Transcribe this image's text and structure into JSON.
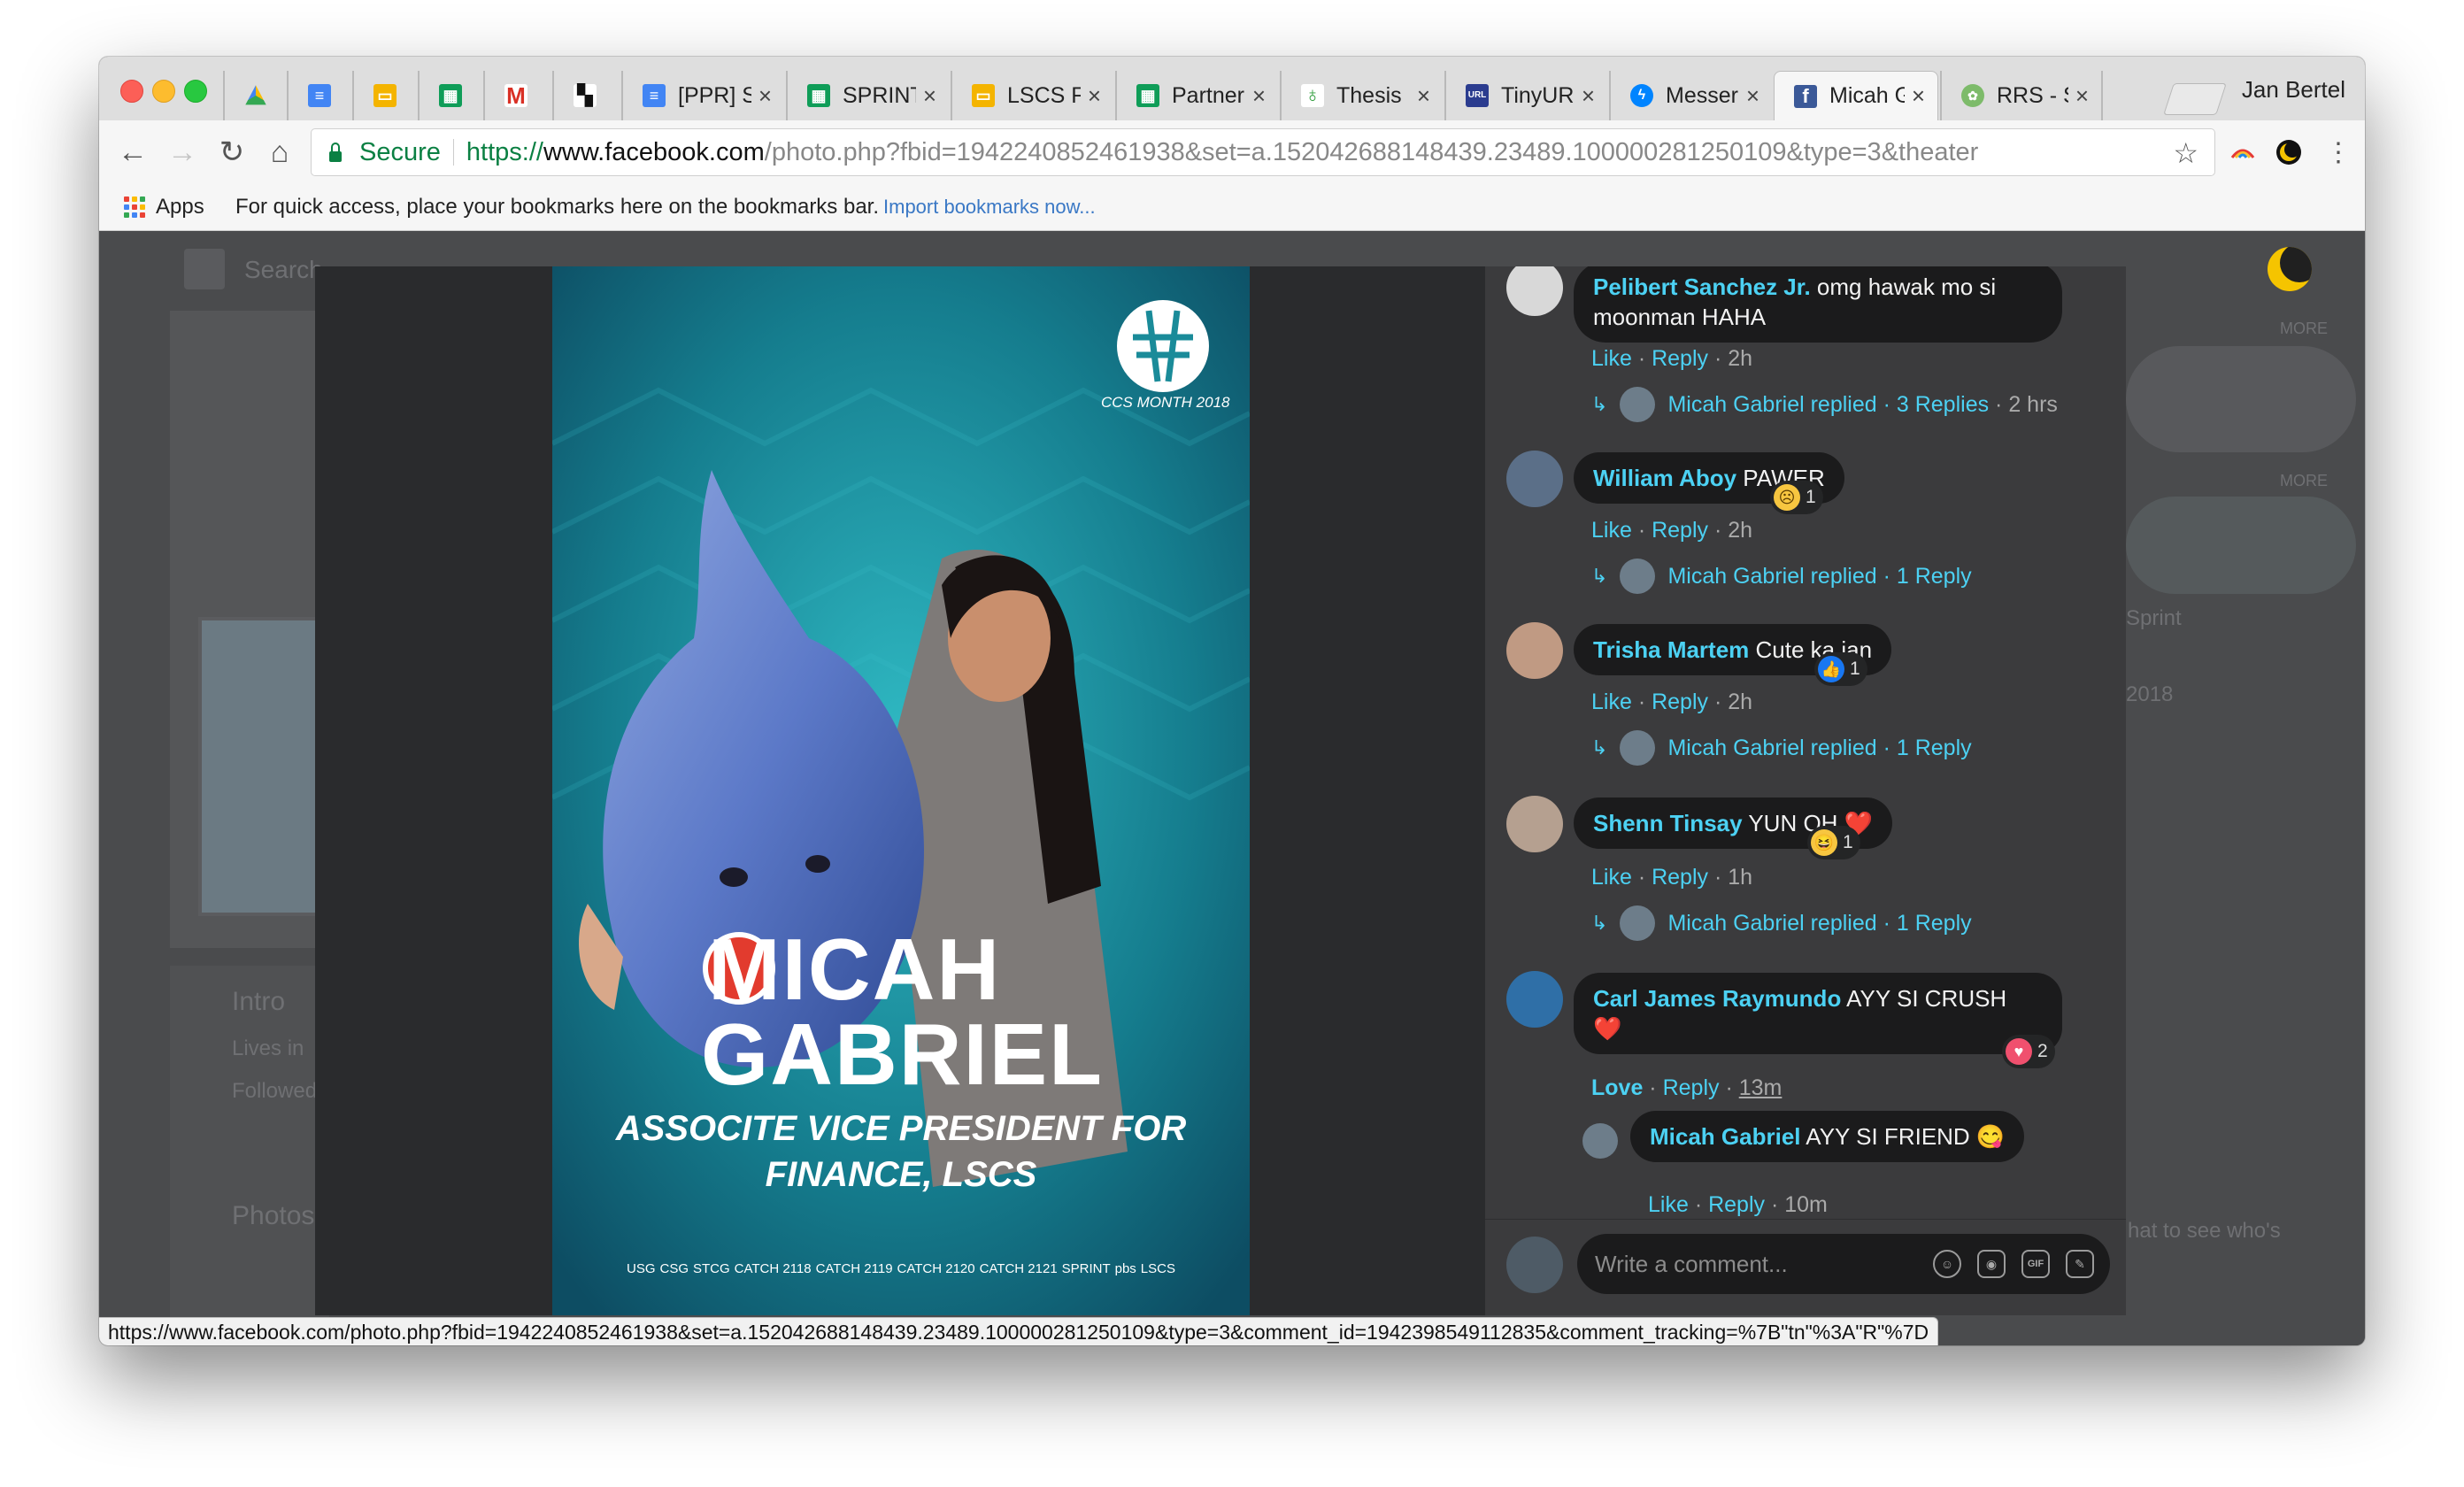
{
  "browser": {
    "tabs": [
      {
        "label": "",
        "icon": "google-drive-icon",
        "active": false
      },
      {
        "label": "",
        "icon": "google-docs-icon",
        "active": false
      },
      {
        "label": "",
        "icon": "google-slides-icon",
        "active": false
      },
      {
        "label": "",
        "icon": "google-sheets-icon",
        "active": false
      },
      {
        "label": "",
        "icon": "gmail-icon",
        "active": false
      },
      {
        "label": "",
        "icon": "app-grid-icon",
        "active": false
      },
      {
        "label": "[PPR] S",
        "icon": "google-docs-icon",
        "active": false
      },
      {
        "label": "SPRINT",
        "icon": "google-sheets-icon",
        "active": false
      },
      {
        "label": "LSCS F",
        "icon": "google-slides-icon",
        "active": false
      },
      {
        "label": "Partner",
        "icon": "google-sheets-icon",
        "active": false
      },
      {
        "label": "Thesis",
        "icon": "leaf-icon",
        "active": false
      },
      {
        "label": "TinyUR",
        "icon": "tinyurl-icon",
        "active": false
      },
      {
        "label": "Messer",
        "icon": "messenger-icon",
        "active": false
      },
      {
        "label": "Micah G",
        "icon": "facebook-icon",
        "active": true
      },
      {
        "label": "RRS - S",
        "icon": "rrs-icon",
        "active": false
      }
    ],
    "tab_close": "×",
    "profile_name": "Jan Bertel",
    "nav": {
      "back": "←",
      "forward": "→",
      "reload": "↻",
      "home": "⌂",
      "star": "☆"
    },
    "address": {
      "secure_label": "Secure",
      "scheme": "https://",
      "host": "www.facebook.com",
      "path": "/photo.php?fbid=1942240852461938&set=a.152042688148439.23489.100000281250109&type=3&theater"
    },
    "bookmarks": {
      "apps_label": "Apps",
      "hint": "For quick access, place your bookmarks here on the bookmarks bar.",
      "import_link": "Import bookmarks now..."
    },
    "status_url": "https://www.facebook.com/photo.php?fbid=1942240852461938&set=a.152042688148439.23489.100000281250109&type=3&comment_id=1942398549112835&comment_tracking=%7B\"tn\"%3A\"R\"%7D",
    "accent": "#4cd1f3"
  },
  "background_page": {
    "search_placeholder": "Search",
    "intro": "Intro",
    "lives_in": "Lives in",
    "followed": "Followed",
    "photos": "Photos",
    "more_1": "MORE",
    "more_2": "MORE",
    "chat_hint": "hat to see who's",
    "sprint": "Sprint",
    "year": "2018"
  },
  "poster": {
    "logo_caption": "CCS MONTH 2018",
    "first_name": "MICAH",
    "last_name": "GABRIEL",
    "position_line1": "ASSOCITE VICE PRESIDENT FOR",
    "position_line2": "FINANCE, LSCS",
    "org_logos": [
      "USG",
      "CSG",
      "STCG",
      "CATCH 2118",
      "CATCH 2119",
      "CATCH 2120",
      "CATCH 2121",
      "SPRINT",
      "pbs",
      "LSCS"
    ]
  },
  "comments": [
    {
      "name": "Pelibert Sanchez Jr.",
      "text": "omg hawak mo si moonman HAHA",
      "actions": {
        "like": "Like",
        "reply": "Reply",
        "time": "2h"
      },
      "replied": {
        "by": "Micah Gabriel replied",
        "count": "3 Replies",
        "time": "2 hrs"
      }
    },
    {
      "name": "William Aboy",
      "text": "PAWER",
      "reaction": {
        "type": "sad",
        "count": "1"
      },
      "actions": {
        "like": "Like",
        "reply": "Reply",
        "time": "2h"
      },
      "replied": {
        "by": "Micah Gabriel replied",
        "count": "1 Reply"
      }
    },
    {
      "name": "Trisha Martem",
      "text": "Cute ka jan",
      "reaction": {
        "type": "like",
        "count": "1"
      },
      "actions": {
        "like": "Like",
        "reply": "Reply",
        "time": "2h"
      },
      "replied": {
        "by": "Micah Gabriel replied",
        "count": "1 Reply"
      }
    },
    {
      "name": "Shenn Tinsay",
      "text": "YUN OH ❤️",
      "reaction": {
        "type": "haha",
        "count": "1"
      },
      "actions": {
        "like": "Like",
        "reply": "Reply",
        "time": "1h"
      },
      "replied": {
        "by": "Micah Gabriel replied",
        "count": "1 Reply"
      }
    },
    {
      "name": "Carl James Raymundo",
      "text": "AYY SI CRUSH",
      "text2": "❤️",
      "reaction": {
        "type": "love",
        "count": "2"
      },
      "actions": {
        "like": "Love",
        "reply": "Reply",
        "time": "13m"
      }
    }
  ],
  "reply": {
    "name": "Micah Gabriel",
    "text": "AYY SI FRIEND 😋",
    "actions": {
      "like": "Like",
      "reply": "Reply",
      "time": "10m"
    }
  },
  "composer": {
    "placeholder": "Write a comment...",
    "icons": [
      "emoji-icon",
      "camera-icon",
      "gif-icon",
      "sticker-icon"
    ],
    "gif_label": "GIF"
  }
}
